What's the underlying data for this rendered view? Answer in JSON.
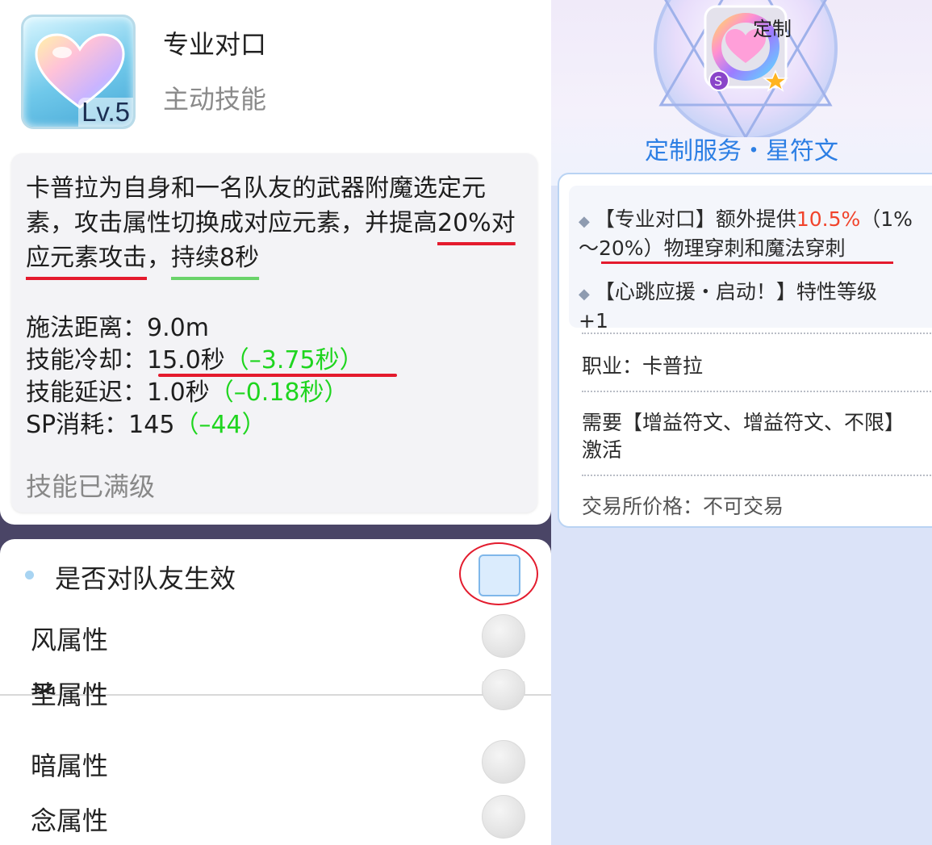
{
  "skill": {
    "name": "专业对口",
    "type": "主动技能",
    "level": "Lv.5",
    "icon": "heart-skill-icon"
  },
  "description": {
    "part1": "卡普拉为自身和一名队友的武器附魔选定元素，攻击属性切换成对应元素，并提高",
    "highlight_red": "20%对应元素攻击",
    "sep": "，",
    "highlight_green": "持续8秒"
  },
  "stats": {
    "range_label": "施法距离：",
    "range_value": "9.0m",
    "cooldown_label": "技能冷却：",
    "cooldown_value": "15.0秒",
    "cooldown_bonus": "（–3.75秒）",
    "delay_label": "技能延迟：",
    "delay_value": "1.0秒",
    "delay_bonus": "（–0.18秒）",
    "sp_label": "SP消耗：",
    "sp_value": "145",
    "sp_bonus": "（–44）"
  },
  "status_text": "技能已满级",
  "settings": {
    "team_label": "是否对队友生效",
    "attributes": [
      {
        "label": "风属性"
      },
      {
        "label": "地属性"
      },
      {
        "label": "圣属性"
      },
      {
        "label": "暗属性"
      },
      {
        "label": "念属性"
      }
    ]
  },
  "rune": {
    "badge": "定制",
    "grade": "S",
    "title": "定制服务・星符文",
    "effect1_prefix": "【专业对口】额外提供",
    "effect1_value": "10.5%",
    "effect1_range": "（1%",
    "effect1_line2": "～20%）物理穿刺和魔法穿刺",
    "effect2_line1": "【心跳应援・启动！】特性等级",
    "effect2_line2": "+1",
    "class_line": "职业：卡普拉",
    "require_line1": "需要【增益符文、增益符文、不限】",
    "require_line2": "激活",
    "trade_line": "交易所价格：不可交易"
  },
  "colors": {
    "accent_blue": "#2d7fe4",
    "bonus_green": "#1fd51f",
    "highlight_red": "#f1442c",
    "annotation_red": "#e41a2d"
  }
}
